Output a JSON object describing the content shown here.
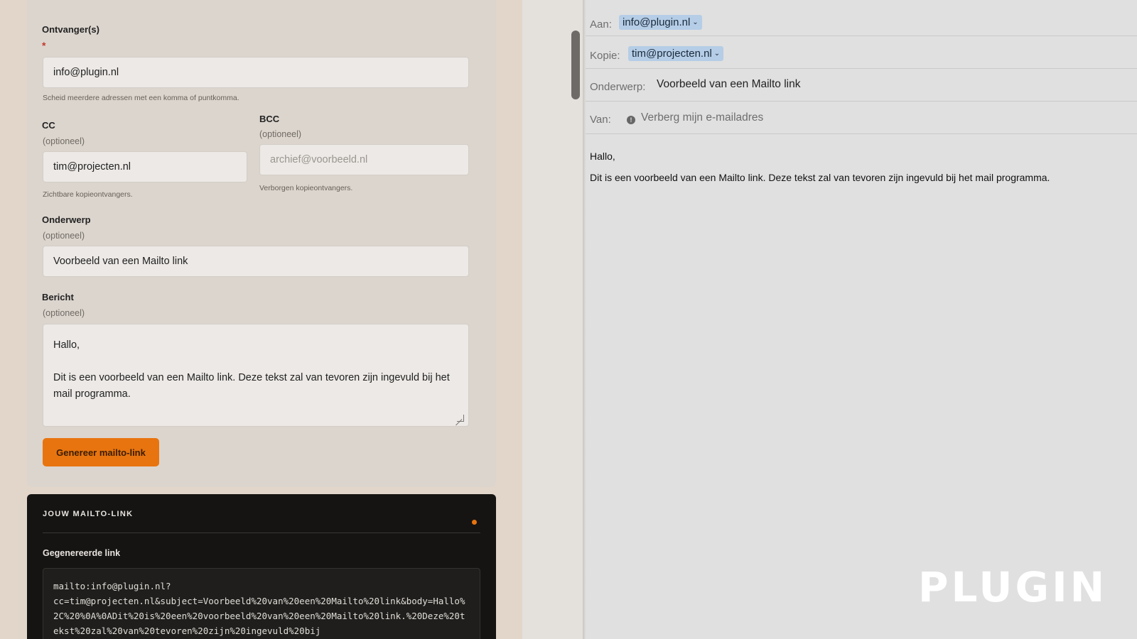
{
  "form": {
    "recipients": {
      "label": "Ontvanger(s)",
      "required_mark": "*",
      "value": "info@plugin.nl",
      "hint": "Scheid meerdere adressen met een komma of puntkomma."
    },
    "cc": {
      "label": "CC",
      "optional": "(optioneel)",
      "value": "tim@projecten.nl",
      "hint": "Zichtbare kopieontvangers."
    },
    "bcc": {
      "label": "BCC",
      "optional": "(optioneel)",
      "placeholder": "archief@voorbeeld.nl",
      "hint": "Verborgen kopieontvangers."
    },
    "subject": {
      "label": "Onderwerp",
      "optional": "(optioneel)",
      "value": "Voorbeeld van een Mailto link"
    },
    "message": {
      "label": "Bericht",
      "optional": "(optioneel)",
      "line1": "Hallo,",
      "line2": "Dit is een voorbeeld van een Mailto link. Deze tekst zal van tevoren zijn ingevuld bij het mail programma."
    },
    "generate_button": "Genereer mailto-link"
  },
  "result": {
    "title": "JOUW MAILTO-LINK",
    "label": "Gegenereerde link",
    "link": "mailto:info@plugin.nl?\ncc=tim@projecten.nl&subject=Voorbeeld%20van%20een%20Mailto%20link&body=Hallo%2C%20%0A%0ADit%20is%20een%20voorbeeld%20van%20een%20Mailto%20link.%20Deze%20tekst%20zal%20van%20tevoren%20zijn%20ingevuld%20bij"
  },
  "mail": {
    "to_label": "Aan:",
    "to_value": "info@plugin.nl",
    "cc_label": "Kopie:",
    "cc_value": "tim@projecten.nl",
    "subject_label": "Onderwerp:",
    "subject_value": "Voorbeeld van een Mailto link",
    "from_label": "Van:",
    "from_value": "Verberg mijn e-mailadres",
    "body_line1": "Hallo,",
    "body_line2": "Dit is een voorbeeld van een Mailto link. Deze tekst zal van tevoren zijn ingevuld bij het mail programma."
  },
  "logo": "PLUGIN",
  "icons": {
    "chip_chevron": "chevron-down-icon",
    "from_info": "info-icon"
  },
  "colors": {
    "accent": "#e8740f",
    "chip": "#b5cde6",
    "dark_card": "#151412"
  }
}
